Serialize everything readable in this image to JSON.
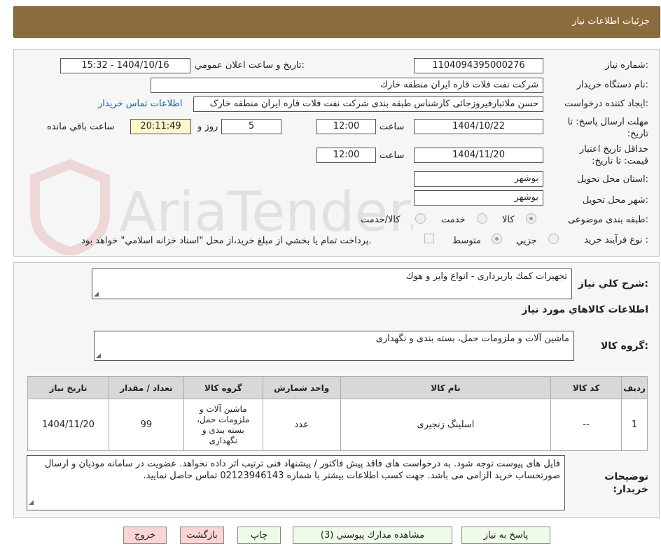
{
  "header": {
    "title": "جزئیات اطلاعات نیاز"
  },
  "labels": {
    "need_number": "شماره نیاز:",
    "announce_datetime": "تاریخ و ساعت اعلان عمومي:",
    "buyer_org": "نام دستگاه خريدار:",
    "requester": "ايجاد كننده درخواست:",
    "send_deadline": "مهلت ارسال پاسخ: تا تاريخ:",
    "time": "ساعت",
    "day_and": "روز و",
    "remaining": "ساعت باقي مانده",
    "price_validity": "حداقل تاريخ اعتبار قيمت: تا تاريخ:",
    "province": "استان محل تحويل:",
    "city": "شهر محل تحويل:",
    "category": "طبقه بندی موضوعی:",
    "process_type": "نوع فرآيند خريد :",
    "payment_note": "پرداخت تمام يا بخشي از مبلغ خريد،از محل \"اسناد خزانه اسلامي\" خواهد بود.",
    "general_desc": "شرح كلي نياز:",
    "items_info": "اطلاعات كالاهاي مورد نياز",
    "goods_group": "گروه كالا:",
    "buyer_notes": "توضيحات خريدار:"
  },
  "values": {
    "need_number": "1104094395000276",
    "announce_datetime": "1404/10/16 - 15:32",
    "buyer_org": "شركت نفت فلات قاره ايران منطقه خارك",
    "requester": "حسن ملاتبارفیروزجائی کارشناس طبقه بندی  شرکت نفت فلات قاره ایران منطقه خارک",
    "contact_link": "اطلاعات تماس خريدار",
    "send_date": "1404/10/22",
    "send_time": "12:00",
    "days_left": "5",
    "time_left": "20:11:49",
    "validity_date": "1404/11/20",
    "validity_time": "12:00",
    "province": "بوشهر",
    "city": "بوشهر",
    "general_desc": "تجهيزات كمك باربرداری - انواع واير و هوك",
    "goods_group": "ماشين آلات و ملزومات حمل، بسته بندی و نگهداری",
    "buyer_notes": "فایل های پیوست توجه شود. به درخواست های فاقد پیش فاکتور / پیشنهاد فنی ترتیب اثر داده نخواهد. عضویت در سامانه مودیان و ارسال صورتحساب خرید الزامی می باشد. جهت کسب اطلاعات بیشتر با شماره 02123946143 تماس حاصل نمایید."
  },
  "category_options": [
    "كالا",
    "خدمت",
    "كالا/خدمت"
  ],
  "category_selected": "كالا",
  "process_options": [
    "جزيي",
    "متوسط"
  ],
  "process_selected": "متوسط",
  "watermark": "AriaTender.net",
  "table": {
    "headers": [
      "رديف",
      "كد كالا",
      "نام كالا",
      "واحد شمارش",
      "گروه كالا",
      "تعداد / مقدار",
      "تاريخ نياز"
    ],
    "rows": [
      [
        "1",
        "--",
        "اسلینگ زنجیری",
        "عدد",
        "ماشين آلات و ملزومات حمل، بسته بندی و نگهداری",
        "99",
        "1404/11/20"
      ]
    ]
  },
  "buttons": {
    "reply": "پاسخ به نياز",
    "attachments": "مشاهده مدارك پيوستي (3)",
    "print": "چاپ",
    "back": "بازگشت",
    "exit": "خروج"
  }
}
